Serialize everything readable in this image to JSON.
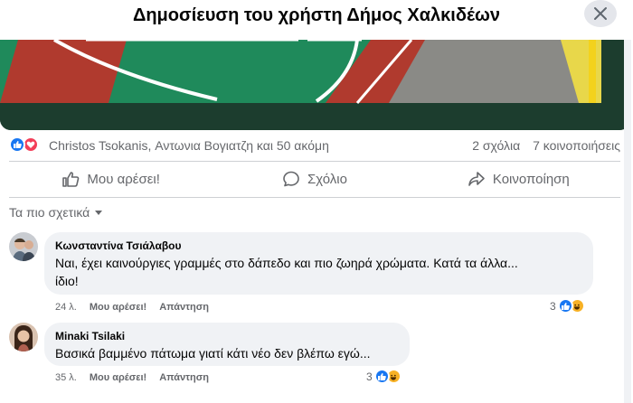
{
  "header": {
    "title": "Δημοσίευση του χρήστη Δήμος Χαλκιδέων",
    "close_icon": "close-icon"
  },
  "post": {
    "photo_alt": "",
    "reactors": "Christos Tsokanis, Αντωνια Βογιατζη και 50 ακόμη",
    "comments_count": "2 σχόλια",
    "shares_count": "7 κοινοποιήσεις"
  },
  "actions": {
    "like": "Μου αρέσει!",
    "comment": "Σχόλιο",
    "share": "Κοινοποίηση"
  },
  "sort_label": "Τα πιο σχετικά",
  "comments": [
    {
      "author": "Κωνσταντίνα Τσιάλαβου",
      "text_line1": "Ναι, έχει καινούργιες γραμμές στο δάπεδο και πιο ζωηρά χρώματα. Κατά τα άλλα...",
      "text_line2": "ίδιο!",
      "time": "24 λ.",
      "like": "Μου αρέσει!",
      "reply": "Απάντηση",
      "reaction_count": "3"
    },
    {
      "author": "Minaki Tsilaki",
      "text_line1": "Βασικά βαμμένο πάτωμα γιατί κάτι νέο δεν βλέπω εγώ...",
      "time": "35 λ.",
      "like": "Μου αρέσει!",
      "reply": "Απάντηση",
      "reaction_count": "3"
    }
  ],
  "colors": {
    "brand_blue": "#1877f2",
    "love_red": "#f33e58",
    "haha_yellow": "#f7b125",
    "court_green": "#1f8a5b",
    "court_red": "#b03a2e",
    "muted_text": "#65676b",
    "bubble_bg": "#f0f2f5"
  }
}
